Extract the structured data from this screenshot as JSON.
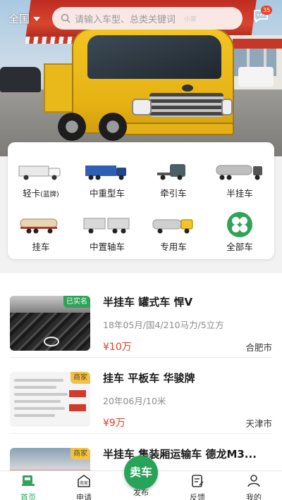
{
  "header": {
    "region": "全国",
    "search_placeholder": "请输入车型、总类关键词",
    "search_ad_text": "小家",
    "message_badge": "35"
  },
  "categories": [
    {
      "label": "轻卡",
      "label_suffix": "(蓝牌)",
      "icon": "light-truck-icon"
    },
    {
      "label": "中重型车",
      "icon": "dump-truck-icon"
    },
    {
      "label": "牵引车",
      "icon": "tractor-truck-icon"
    },
    {
      "label": "半挂车",
      "icon": "semi-trailer-icon"
    },
    {
      "label": "挂车",
      "icon": "tank-trailer-icon"
    },
    {
      "label": "中置轴车",
      "icon": "center-axle-truck-icon"
    },
    {
      "label": "专用车",
      "icon": "special-vehicle-icon"
    },
    {
      "label": "全部车",
      "icon": "all-vehicles-icon"
    }
  ],
  "listings": [
    {
      "title": "半挂车 罐式车 悍V",
      "spec": "18年05月/国4/210马力/5立方",
      "price": "¥10万",
      "city": "合肥市",
      "tag": "已实名"
    },
    {
      "title": "挂车 平板车 华骏牌",
      "spec": "20年06月/10米",
      "price": "¥9万",
      "city": "天津市",
      "tag": "商家"
    },
    {
      "title": "半挂车 集装厢运输车 德龙M3...",
      "spec": "",
      "price": "",
      "city": "",
      "tag": "商家"
    }
  ],
  "nav": {
    "home": "首页",
    "apply": "申请",
    "publish": "发布",
    "sell_button": "卖车",
    "feedback": "反馈",
    "mine": "我的"
  },
  "colors": {
    "accent": "#2fa35a",
    "price": "#e23d2a"
  }
}
